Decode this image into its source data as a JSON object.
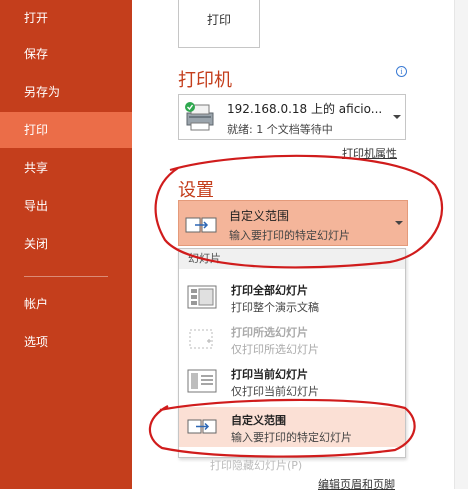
{
  "sidebar": {
    "items": [
      {
        "label": "打开"
      },
      {
        "label": "保存"
      },
      {
        "label": "另存为"
      },
      {
        "label": "打印"
      },
      {
        "label": "共享"
      },
      {
        "label": "导出"
      },
      {
        "label": "关闭"
      },
      {
        "label": "帐户"
      },
      {
        "label": "选项"
      }
    ],
    "active_index": 3
  },
  "print": {
    "button_label": "打印"
  },
  "printer": {
    "section_title": "打印机",
    "name": "192.168.0.18 上的 aficio...",
    "status": "就绪: 1 个文档等待中",
    "properties_link": "打印机属性"
  },
  "settings": {
    "section_title": "设置",
    "selected_title": "自定义范围",
    "selected_subtitle": "输入要打印的特定幻灯片"
  },
  "dropdown": {
    "header": "幻灯片",
    "options": [
      {
        "title": "打印全部幻灯片",
        "subtitle": "打印整个演示文稿",
        "enabled": true
      },
      {
        "title": "打印所选幻灯片",
        "subtitle": "仅打印所选幻灯片",
        "enabled": false
      },
      {
        "title": "打印当前幻灯片",
        "subtitle": "仅打印当前幻灯片",
        "enabled": true
      },
      {
        "title": "自定义范围",
        "subtitle": "输入要打印的特定幻灯片",
        "enabled": true
      }
    ],
    "faded_item": "打印隐藏幻灯片(P)"
  },
  "footer": {
    "edit_header_footer_link": "编辑页眉和页脚"
  },
  "colors": {
    "sidebar_bg": "#c43e1c",
    "sidebar_active": "#eb6d48",
    "accent_text": "#c43e1c",
    "selected_bg": "#f4b59a",
    "annotation_red": "#d01c1c"
  }
}
